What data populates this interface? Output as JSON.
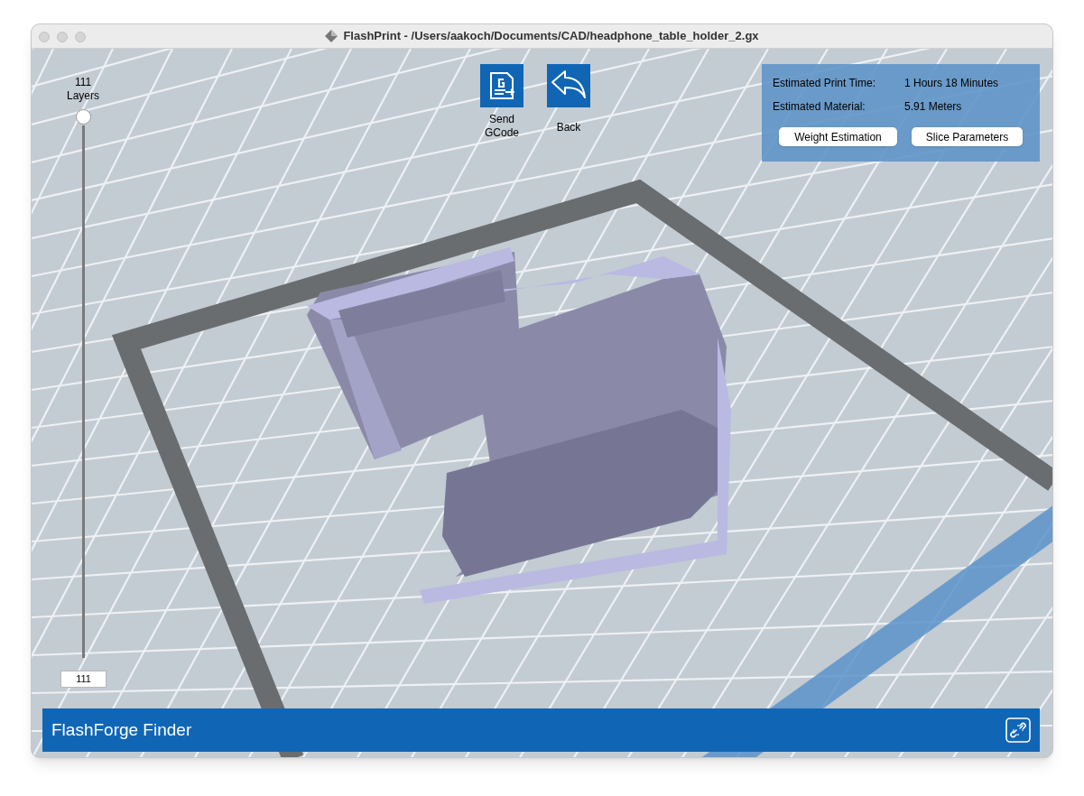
{
  "window": {
    "title": "FlashPrint - /Users/aakoch/Documents/CAD/headphone_table_holder_2.gx"
  },
  "layer_slider": {
    "count": "111",
    "label": "Layers",
    "level": 1,
    "value": "111"
  },
  "toolbar": [
    {
      "kind": "gcode",
      "label": "Send\nGCode"
    },
    {
      "kind": "back",
      "label": "Back"
    }
  ],
  "estimate": {
    "rows": [
      {
        "label": "Estimated Print Time:",
        "value": "1 Hours 18 Minutes"
      },
      {
        "label": "Estimated Material:",
        "value": "5.91 Meters"
      }
    ],
    "buttons": [
      "Weight Estimation",
      "Slice Parameters"
    ]
  },
  "status_bar": {
    "printer": "FlashForge Finder"
  }
}
